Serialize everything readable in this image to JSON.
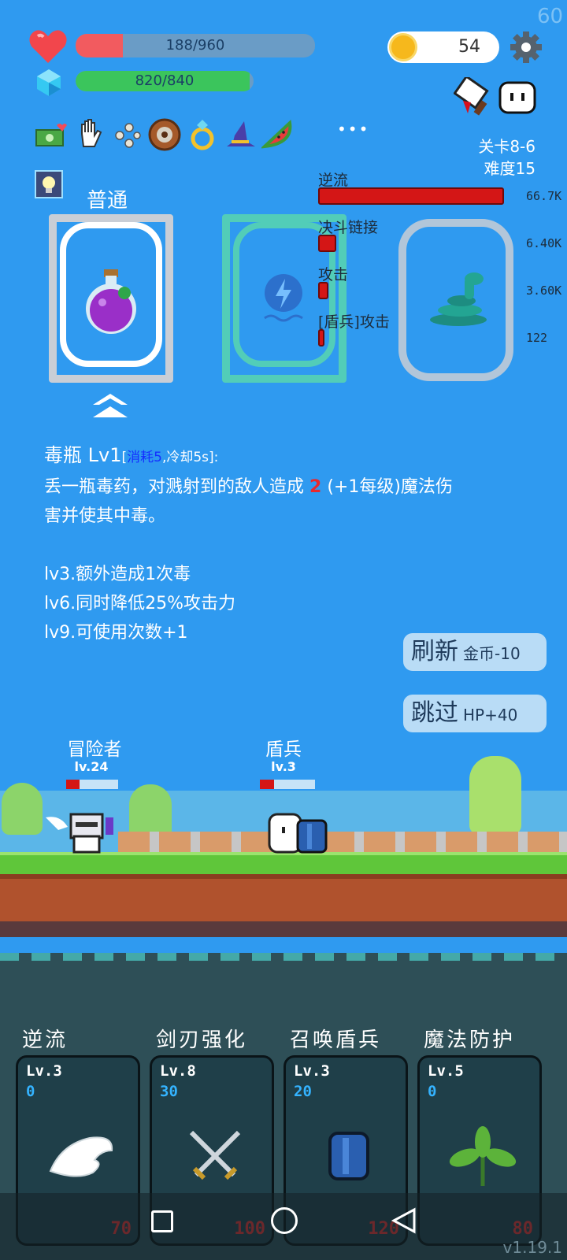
{
  "fps": "60",
  "hp": {
    "text": "188/960",
    "fraction": 0.196,
    "color": "#f25b5f"
  },
  "mp": {
    "text": "820/840",
    "fraction": 0.976,
    "color": "#3bc55c"
  },
  "coins": "54",
  "stage": {
    "level": "关卡8-6",
    "difficulty": "难度15"
  },
  "more_label": "•••",
  "rarity": "普通",
  "damage_stats": [
    {
      "label": "逆流",
      "value": "66.7K",
      "fraction": 1.0
    },
    {
      "label": "决斗链接",
      "value": "6.40K",
      "fraction": 0.096
    },
    {
      "label": "攻击",
      "value": "3.60K",
      "fraction": 0.054
    },
    {
      "label": "[盾兵]攻击",
      "value": "122",
      "fraction": 0.018
    }
  ],
  "skill_desc": {
    "name": "毒瓶 Lv1",
    "cost": "消耗5",
    "cooldown": ",冷却5s]:",
    "bracket_open": "[",
    "line1_a": "丢一瓶毒药，对溅射到的敌人造成",
    "line1_num": "2",
    "line1_b": "(+1每级)魔法伤",
    "line2": "害并使其中毒。",
    "lv3": "lv3.额外造成1次毒",
    "lv6": "lv6.同时降低25%攻击力",
    "lv9": "lv9.可使用次数+1"
  },
  "refresh_button": {
    "label": "刷新",
    "sub": "金币-10"
  },
  "skip_button": {
    "label": "跳过",
    "sub": "HP+40"
  },
  "player": {
    "name": "冒险者",
    "level": "lv.24",
    "hp_fraction": 0.25
  },
  "enemy": {
    "name": "盾兵",
    "level": "lv.3",
    "hp_fraction": 0.25
  },
  "cards": [
    {
      "title": "逆流",
      "level": "Lv.3",
      "num": "0",
      "cost": "70"
    },
    {
      "title": "剑刃强化",
      "level": "Lv.8",
      "num": "30",
      "cost": "100"
    },
    {
      "title": "召唤盾兵",
      "level": "Lv.3",
      "num": "20",
      "cost": "120"
    },
    {
      "title": "魔法防护",
      "level": "Lv.5",
      "num": "0",
      "cost": "80"
    }
  ],
  "version": "v1.19.1"
}
